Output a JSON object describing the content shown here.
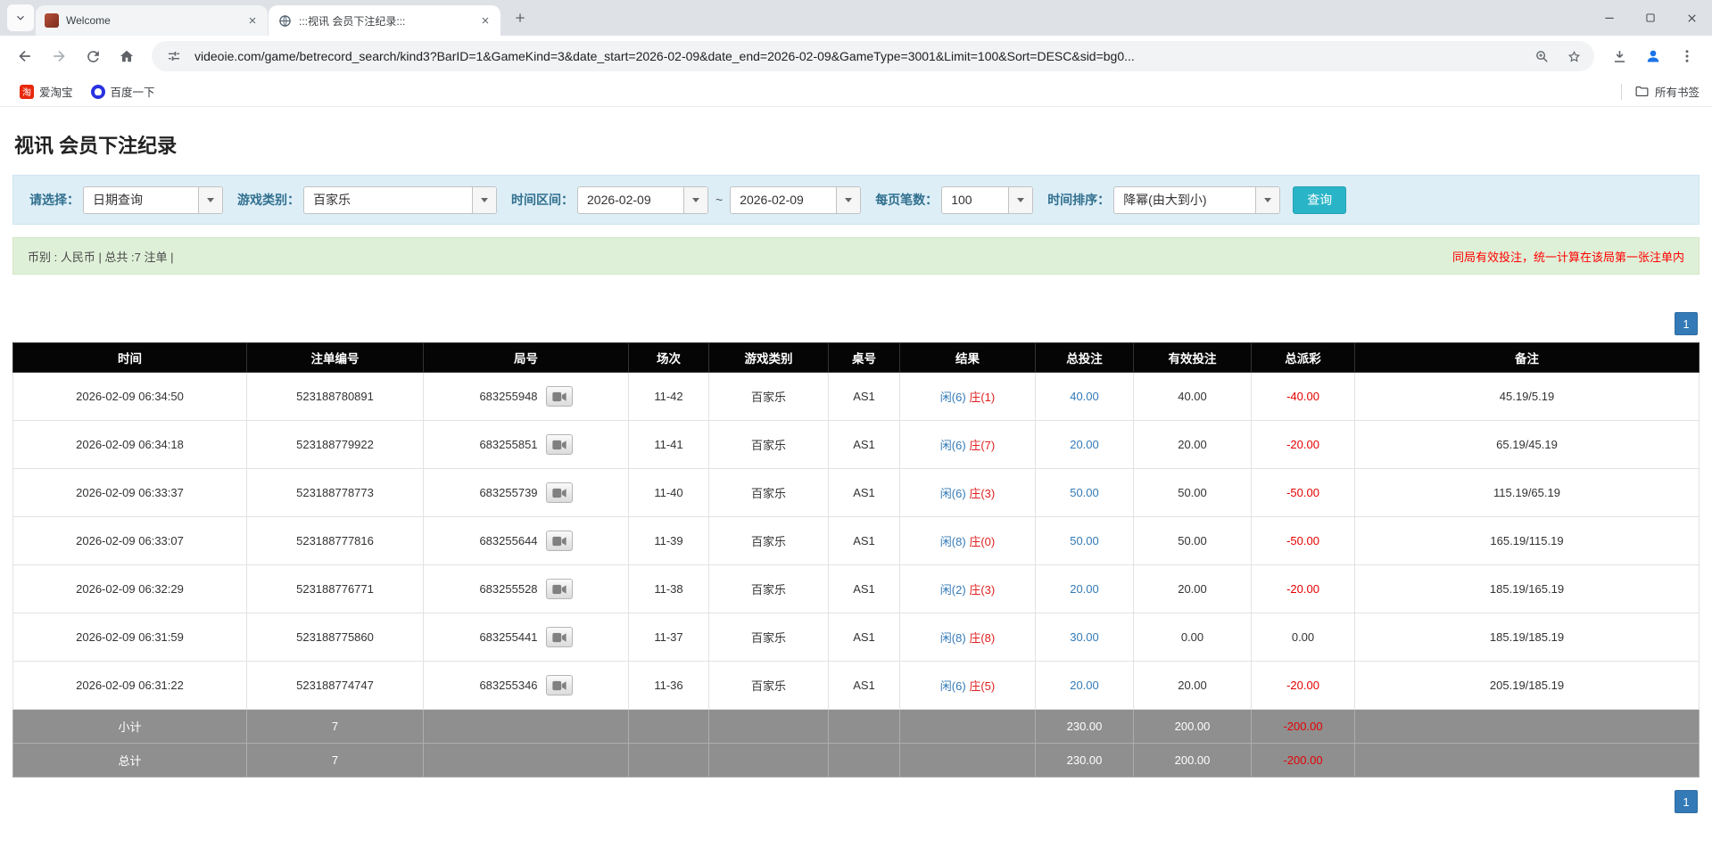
{
  "browser": {
    "tabs": [
      {
        "label": "Welcome"
      },
      {
        "label": ":::视讯 会员下注纪录:::"
      }
    ],
    "url": "videoie.com/game/betrecord_search/kind3?BarID=1&GameKind=3&date_start=2026-02-09&date_end=2026-02-09&GameType=3001&Limit=100&Sort=DESC&sid=bg0...",
    "bookmarks": [
      {
        "label": "爱淘宝"
      },
      {
        "label": "百度一下"
      }
    ],
    "all_bookmarks_label": "所有书签"
  },
  "page": {
    "title": "视讯 会员下注纪录",
    "filters": {
      "select_label": "请选择：",
      "select_value": "日期查询",
      "game_label": "游戏类别：",
      "game_value": "百家乐",
      "range_label": "时间区间：",
      "date_start": "2026-02-09",
      "range_separator": "~",
      "date_end": "2026-02-09",
      "per_page_label": "每页笔数：",
      "per_page_value": "100",
      "sort_label": "时间排序：",
      "sort_value": "降幂(由大到小)",
      "search_button": "查询"
    },
    "summary": {
      "left": "币别 : 人民币 | 总共 :7 注单 |",
      "notice": "同局有效投注，统一计算在该局第一张注单内"
    },
    "pagination_top": "1",
    "pagination_bottom": "1",
    "table": {
      "columns": [
        "时间",
        "注单编号",
        "局号",
        "场次",
        "游戏类别",
        "桌号",
        "结果",
        "总投注",
        "有效投注",
        "总派彩",
        "备注"
      ],
      "rows": [
        {
          "time": "2026-02-09 06:34:50",
          "bet_id": "523188780891",
          "round": "683255948",
          "session": "11-42",
          "game": "百家乐",
          "table": "AS1",
          "result_player": "闲(6)",
          "result_banker": "庄(1)",
          "total_bet": "40.00",
          "valid_bet": "40.00",
          "payout": "-40.00",
          "note": "45.19/5.19"
        },
        {
          "time": "2026-02-09 06:34:18",
          "bet_id": "523188779922",
          "round": "683255851",
          "session": "11-41",
          "game": "百家乐",
          "table": "AS1",
          "result_player": "闲(6)",
          "result_banker": "庄(7)",
          "total_bet": "20.00",
          "valid_bet": "20.00",
          "payout": "-20.00",
          "note": "65.19/45.19"
        },
        {
          "time": "2026-02-09 06:33:37",
          "bet_id": "523188778773",
          "round": "683255739",
          "session": "11-40",
          "game": "百家乐",
          "table": "AS1",
          "result_player": "闲(6)",
          "result_banker": "庄(3)",
          "total_bet": "50.00",
          "valid_bet": "50.00",
          "payout": "-50.00",
          "note": "115.19/65.19"
        },
        {
          "time": "2026-02-09 06:33:07",
          "bet_id": "523188777816",
          "round": "683255644",
          "session": "11-39",
          "game": "百家乐",
          "table": "AS1",
          "result_player": "闲(8)",
          "result_banker": "庄(0)",
          "total_bet": "50.00",
          "valid_bet": "50.00",
          "payout": "-50.00",
          "note": "165.19/115.19"
        },
        {
          "time": "2026-02-09 06:32:29",
          "bet_id": "523188776771",
          "round": "683255528",
          "session": "11-38",
          "game": "百家乐",
          "table": "AS1",
          "result_player": "闲(2)",
          "result_banker": "庄(3)",
          "total_bet": "20.00",
          "valid_bet": "20.00",
          "payout": "-20.00",
          "note": "185.19/165.19"
        },
        {
          "time": "2026-02-09 06:31:59",
          "bet_id": "523188775860",
          "round": "683255441",
          "session": "11-37",
          "game": "百家乐",
          "table": "AS1",
          "result_player": "闲(8)",
          "result_banker": "庄(8)",
          "total_bet": "30.00",
          "valid_bet": "0.00",
          "payout": "0.00",
          "note": "185.19/185.19"
        },
        {
          "time": "2026-02-09 06:31:22",
          "bet_id": "523188774747",
          "round": "683255346",
          "session": "11-36",
          "game": "百家乐",
          "table": "AS1",
          "result_player": "闲(6)",
          "result_banker": "庄(5)",
          "total_bet": "20.00",
          "valid_bet": "20.00",
          "payout": "-20.00",
          "note": "205.19/185.19"
        }
      ],
      "footer_rows": [
        {
          "label": "小计",
          "count": "7",
          "total_bet": "230.00",
          "valid_bet": "200.00",
          "payout": "-200.00"
        },
        {
          "label": "总计",
          "count": "7",
          "total_bet": "230.00",
          "valid_bet": "200.00",
          "payout": "-200.00"
        }
      ]
    },
    "colors": {
      "accent_blue": "#337ab7",
      "negative_red": "#e60000",
      "player_blue": "#337ab7",
      "banker_red": "#e02020",
      "search_button_bg": "#2ab4c8",
      "filter_bar_bg": "#ddeef7",
      "summary_bar_bg": "#dff0d8",
      "table_header_bg": "#050505",
      "footer_row_bg": "#8f8f8f"
    }
  }
}
